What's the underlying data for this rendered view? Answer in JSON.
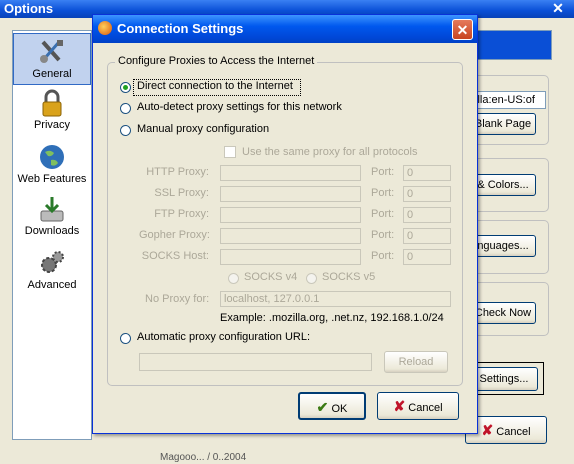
{
  "options_window": {
    "title": "Options",
    "close_glyph": "✕",
    "sidebar": {
      "items": [
        {
          "label": "General",
          "icon": "tools-icon",
          "selected": true
        },
        {
          "label": "Privacy",
          "icon": "lock-icon"
        },
        {
          "label": "Web Features",
          "icon": "globe-icon"
        },
        {
          "label": "Downloads",
          "icon": "downloads-icon"
        },
        {
          "label": "Advanced",
          "icon": "gears-icon"
        }
      ]
    },
    "homepage_fragment": "illa:en-US:of",
    "buttons": {
      "blank_page": "Blank Page",
      "fonts_colors": "& Colors...",
      "languages": "nguages...",
      "check_now": "Check Now",
      "settings": "Settings...",
      "cancel": "Cancel"
    },
    "status_fragment": "Magooo... / 0..2004"
  },
  "dialog": {
    "title": "Connection Settings",
    "group_label": "Configure Proxies to Access the Internet",
    "radios": {
      "direct": "Direct connection to the Internet",
      "autodetect": "Auto-detect proxy settings for this network",
      "manual": "Manual proxy configuration",
      "auto_url": "Automatic proxy configuration URL:"
    },
    "same_proxy": "Use the same proxy for all protocols",
    "proxies": [
      {
        "label": "HTTP Proxy:",
        "port_label": "Port:",
        "port": "0"
      },
      {
        "label": "SSL Proxy:",
        "port_label": "Port:",
        "port": "0"
      },
      {
        "label": "FTP Proxy:",
        "port_label": "Port:",
        "port": "0"
      },
      {
        "label": "Gopher Proxy:",
        "port_label": "Port:",
        "port": "0"
      },
      {
        "label": "SOCKS Host:",
        "port_label": "Port:",
        "port": "0"
      }
    ],
    "socks_v4": "SOCKS v4",
    "socks_v5": "SOCKS v5",
    "no_proxy_label": "No Proxy for:",
    "no_proxy_value": "localhost, 127.0.0.1",
    "example": "Example: .mozilla.org, .net.nz, 192.168.1.0/24",
    "reload": "Reload",
    "ok": "OK",
    "cancel": "Cancel"
  }
}
